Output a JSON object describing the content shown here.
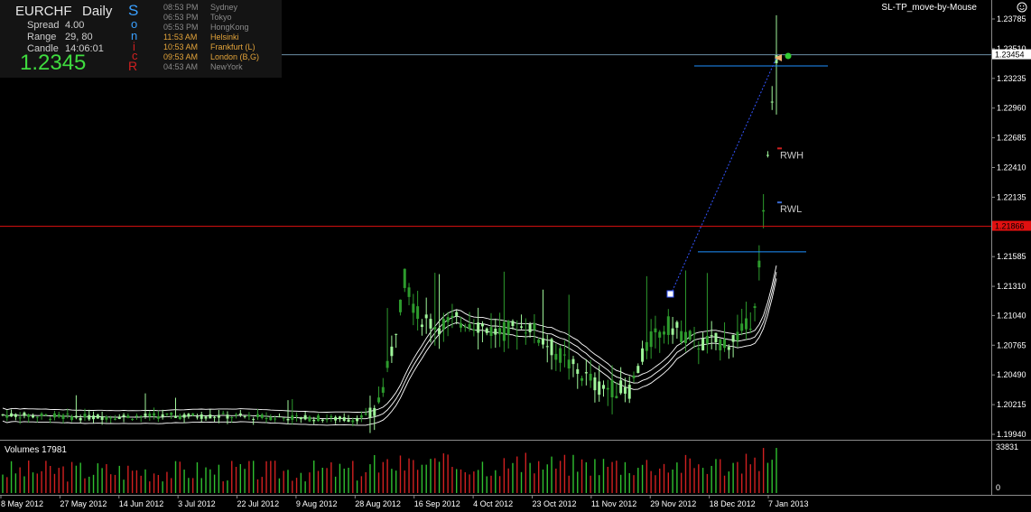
{
  "panel": {
    "symbol": "EURCHF",
    "timeframe": "Daily",
    "spread_label": "Spread",
    "spread_value": "4.00",
    "range_label": "Range",
    "range_value": "29, 80",
    "candle_label": "Candle",
    "candle_value": "14:06:01",
    "price": "1.2345",
    "sonr": [
      "S",
      "o",
      "n",
      "i",
      "c",
      "R"
    ],
    "sessions": [
      {
        "time": "08:53 PM",
        "city": "Sydney",
        "color": "#8a8a8a"
      },
      {
        "time": "06:53 PM",
        "city": "Tokyo",
        "color": "#8a8a8a"
      },
      {
        "time": "05:53 PM",
        "city": "HongKong",
        "color": "#8a8a8a"
      },
      {
        "time": "11:53 AM",
        "city": "Helsinki",
        "color": "#e2a33a"
      },
      {
        "time": "10:53 AM",
        "city": "Frankfurt  (L)",
        "color": "#e2a33a"
      },
      {
        "time": "09:53 AM",
        "city": "London  (B,G)",
        "color": "#e2a33a"
      },
      {
        "time": "04:53 AM",
        "city": "NewYork",
        "color": "#8a8a8a"
      }
    ]
  },
  "indicator_name": "SL-TP_move-by-Mouse",
  "volume_label": "Volumes 17981",
  "chart_data": {
    "type": "candlestick",
    "symbol": "EURCHF",
    "timeframe": "Daily",
    "colors": {
      "bull": "#9ff59a",
      "bear": "#2d9b2d",
      "vol_up": "#2fbf2f",
      "vol_down": "#d02020",
      "bands": "#ffffff",
      "hline": "#e01010",
      "bid_line": "#6b8fa6",
      "sl_tp": "#1e90ff"
    },
    "y_ticks": [
      1.23785,
      1.2351,
      1.23235,
      1.2296,
      1.22685,
      1.2241,
      1.22135,
      1.2186,
      1.21585,
      1.2131,
      1.2104,
      1.20765,
      1.2049,
      1.20215,
      1.1994
    ],
    "ylim": [
      1.1993,
      1.2388
    ],
    "current_price": 1.23454,
    "current_price_label": "1.23454",
    "horizontal_line": 1.21866,
    "horizontal_line_label": "1.21866",
    "x_labels": [
      "8 May 2012",
      "27 May 2012",
      "14 Jun 2012",
      "3 Jul 2012",
      "22 Jul 2012",
      "9 Aug 2012",
      "28 Aug 2012",
      "16 Sep 2012",
      "4 Oct 2012",
      "23 Oct 2012",
      "11 Nov 2012",
      "29 Nov 2012",
      "18 Dec 2012",
      "7 Jan 2013"
    ],
    "annotations": [
      {
        "text": "RWH",
        "price": 1.2252
      },
      {
        "text": "RWL",
        "price": 1.2202
      }
    ],
    "stop_levels": [
      1.2335,
      1.2163
    ],
    "volume_ticks": [
      "33831",
      "0"
    ],
    "volume_max": 33831,
    "bars_count": 180
  }
}
